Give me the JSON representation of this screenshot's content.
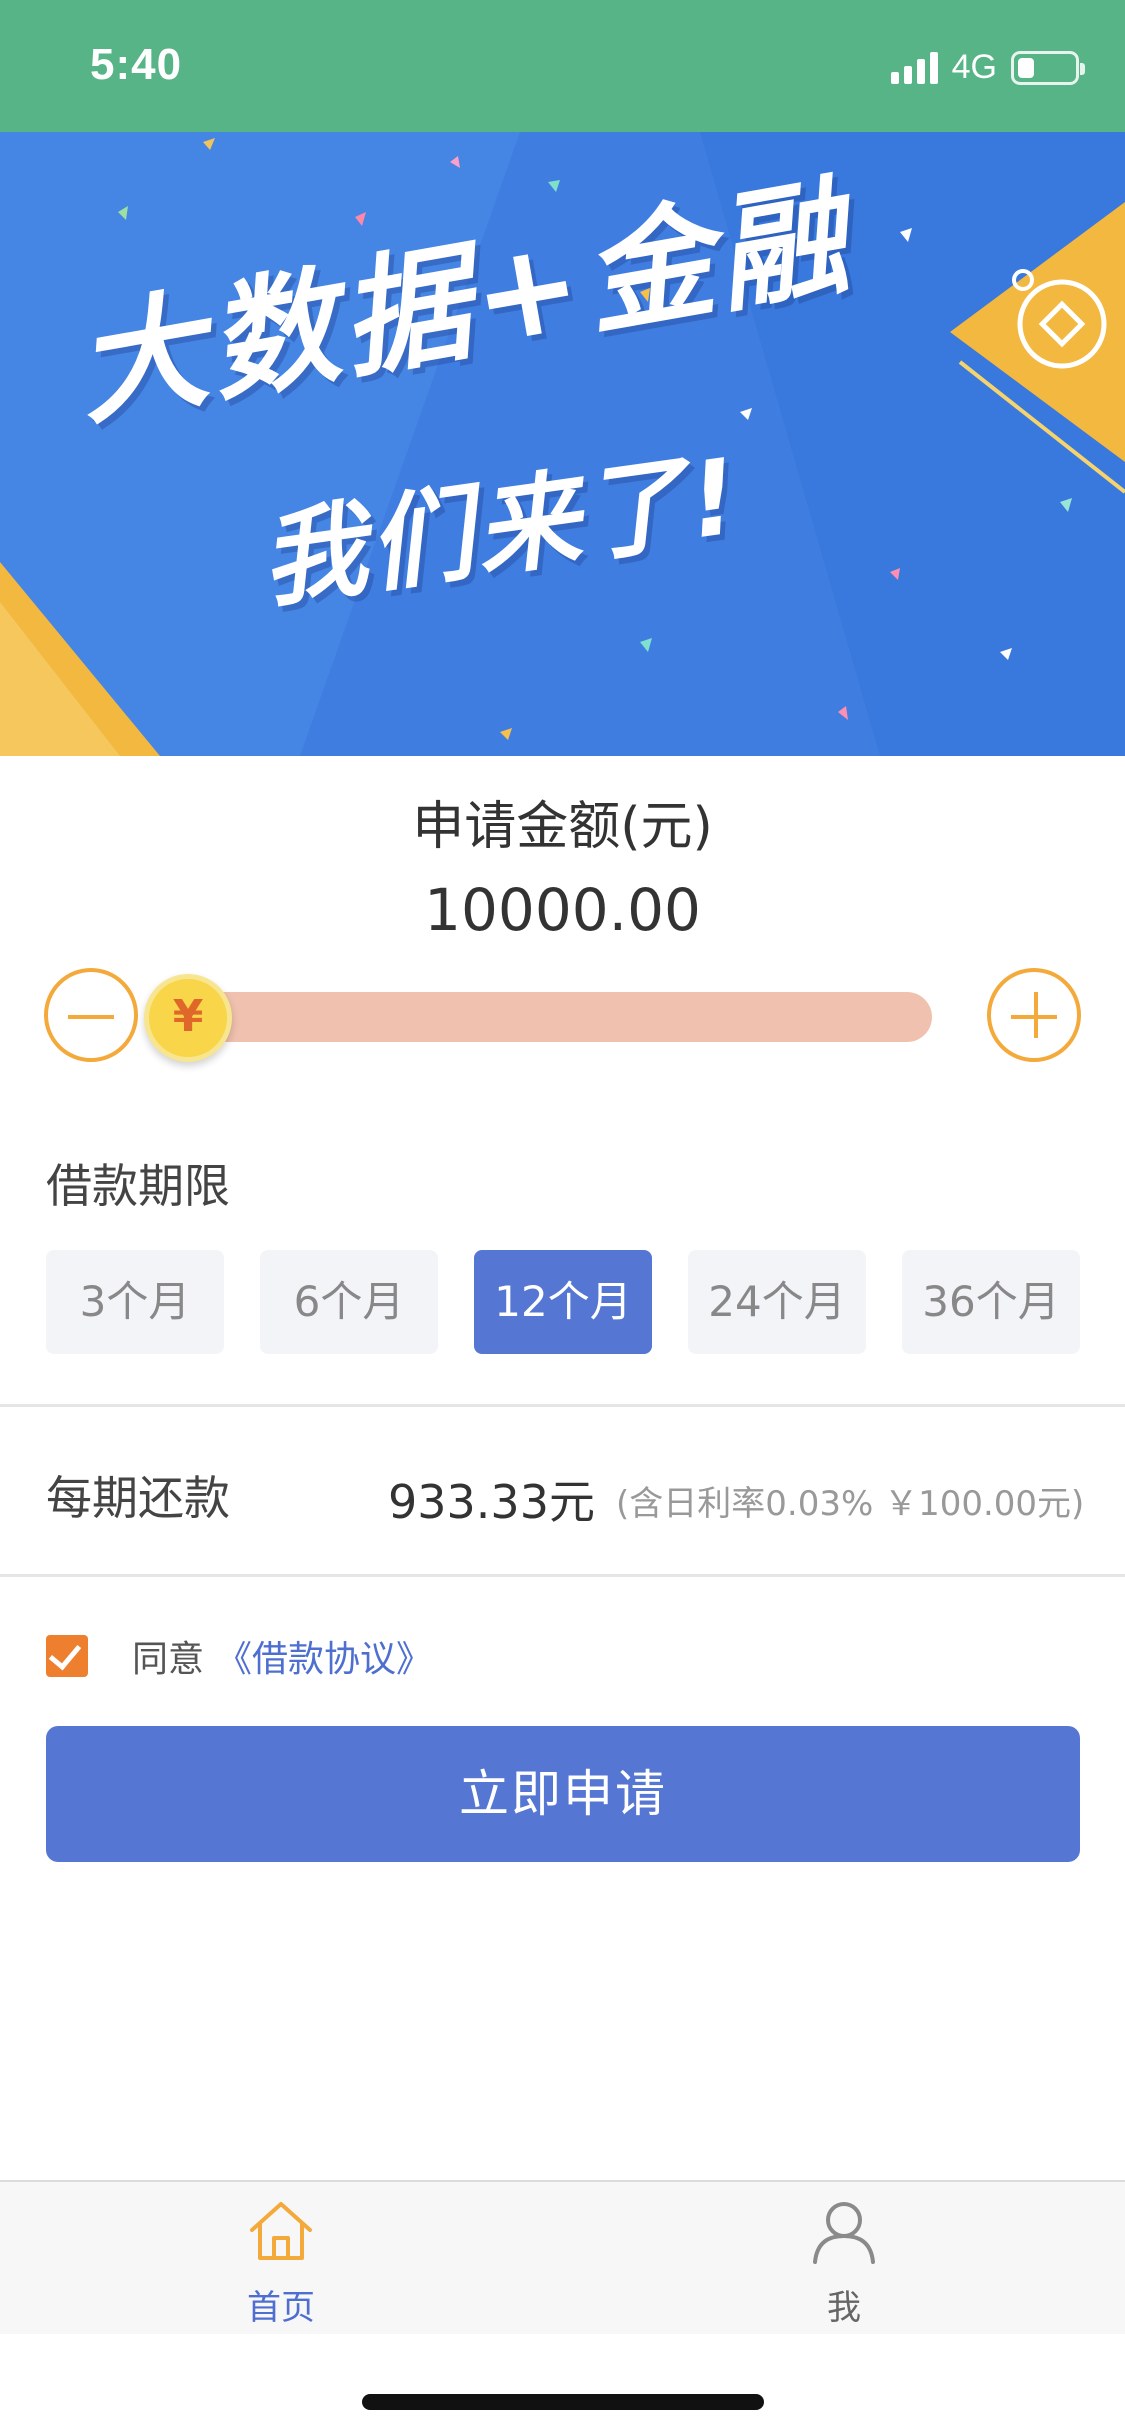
{
  "status_bar": {
    "time": "5:40",
    "network": "4G",
    "battery_level": 0.25,
    "background_color": "#56b487"
  },
  "banner": {
    "line1": "大数据+金融",
    "line2": "我们来了!",
    "background_color": "#3f7ee0",
    "accent_color": "#f3b840"
  },
  "amount": {
    "title": "申请金额(元)",
    "value": "10000.00",
    "slider_fraction": 0.0,
    "thumb_symbol": "¥",
    "minus_icon": "minus-icon",
    "plus_icon": "plus-icon"
  },
  "term": {
    "label": "借款期限",
    "options": [
      "3个月",
      "6个月",
      "12个月",
      "24个月",
      "36个月"
    ],
    "selected": "12个月"
  },
  "repayment": {
    "label": "每期还款",
    "value": "933.33元",
    "note": "(含日利率0.03% ￥100.00元)"
  },
  "agreement": {
    "checked": true,
    "text": "同意",
    "link": "《借款协议》"
  },
  "apply_button": {
    "label": "立即申请",
    "color": "#5577d3"
  },
  "tabbar": {
    "items": [
      {
        "label": "首页",
        "icon": "home-icon",
        "active": true
      },
      {
        "label": "我",
        "icon": "user-icon",
        "active": false
      }
    ]
  }
}
